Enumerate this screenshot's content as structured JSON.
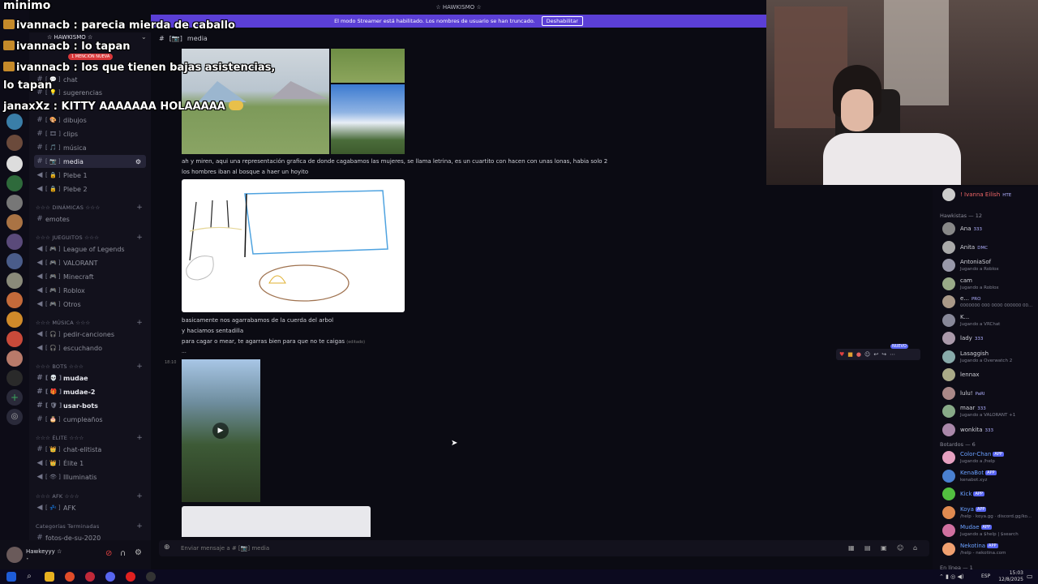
{
  "window": {
    "server_title": "☆ HAWKISMO ☆",
    "banner_text": "El modo Streamer está habilitado. Los nombres de usuario se han truncado.",
    "banner_button": "Deshabilitar"
  },
  "header": {
    "channel": "media",
    "channel_prefix": "[📷]"
  },
  "sidebar": {
    "server_name": "☆ HAWKISMO ☆",
    "mention_badge": "1 MENCIÓN NUEVA",
    "channels_top": [
      {
        "label": "chat"
      },
      {
        "label": "sugerencias"
      },
      {
        "label": "dibujos"
      },
      {
        "label": "clips"
      },
      {
        "label": "música"
      },
      {
        "label": "media",
        "active": true
      },
      {
        "label": "Plebe 1"
      },
      {
        "label": "Plebe 2"
      }
    ],
    "cat_dinamicas": "☆☆☆ DINÁMICAS ☆☆☆",
    "ch_emotes": "emotes",
    "cat_jueguitos": "☆☆☆ JUEGUITOS ☆☆☆",
    "voice_games": [
      "League of Legends",
      "VALORANT",
      "Minecraft",
      "Roblox",
      "Otros"
    ],
    "cat_musica": "☆☆☆ MÚSICA ☆☆☆",
    "voice_music": [
      "pedir-canciones",
      "escuchando"
    ],
    "cat_bots": "☆☆☆ BOTS ☆☆☆",
    "bots": [
      "mudae",
      "mudae-2",
      "usar-bots",
      "cumpleaños"
    ],
    "cat_elite": "☆☆☆ ÉLITE ☆☆☆",
    "elite": [
      "chat-elitista",
      "Élite 1",
      "Illuminatis"
    ],
    "cat_afk": "☆☆☆ AFK ☆☆☆",
    "afk": "AFK",
    "cat_terminadas": "Categorías Terminadas",
    "ch_fotos": "fotos-de-su-2020"
  },
  "user": {
    "name": "Hawkeyyy ☆",
    "status": "•"
  },
  "messages": {
    "m1_line1": "ah y miren, aqui una representación grafica de donde cagabamos las mujeres, se llama letrina, es un cuartito con hacen con unas lonas, habia solo 2",
    "m1_line2": "los hombres iban al bosque a haer un hoyito",
    "m2_line1": "basicamente nos agarrabamos de la cuerda del arbol",
    "m2_line2": "y haciamos sentadilla",
    "m2_line3": "para cagar o mear, te agarras bien para que no te caigas",
    "m2_edited": "(editado)",
    "m2_dots": "...",
    "time": "18:10"
  },
  "composer": {
    "placeholder": "Enviar mensaje a # [📷] media"
  },
  "overlay_chat": [
    {
      "user": "minimo",
      "text": ""
    },
    {
      "user": "ivannacb",
      "text": ": parecia mierda de caballo"
    },
    {
      "user": "ivannacb",
      "text": ": lo tapan"
    },
    {
      "user": "ivannacb",
      "text": ": los que tienen bajas asistencias,"
    },
    {
      "user": "",
      "text": "lo tapan"
    },
    {
      "user": "janaxXz",
      "text": ": KITTY AAAAAAA HOLAAAAA"
    }
  ],
  "reaction_bar": {
    "new_label": "NUEVO"
  },
  "members": {
    "top_member": {
      "name": "! Ivanna Eilish",
      "tag": "HTE"
    },
    "group1_header": "Hawkistas — 12",
    "group1": [
      {
        "name": "Ana",
        "badge": "333",
        "status": ""
      },
      {
        "name": "Anita",
        "badge": "DMC",
        "status": ""
      },
      {
        "name": "AntoniaSof",
        "badge": "",
        "status": "Jugando a Roblox"
      },
      {
        "name": "cam",
        "badge": "",
        "status": "Jugando a Roblox"
      },
      {
        "name": "e...",
        "badge": "PRO",
        "status": "0000000 000 0000 000000 00..."
      },
      {
        "name": "K...",
        "badge": "",
        "status": "Jugando a VRChat"
      },
      {
        "name": "lady",
        "badge": "333",
        "status": ""
      },
      {
        "name": "Lasaggish",
        "badge": "",
        "status": "Jugando a Overwatch 2"
      },
      {
        "name": "lennax",
        "badge": "",
        "status": ""
      },
      {
        "name": "lulu!",
        "badge": "PaRI",
        "status": ""
      },
      {
        "name": "maar",
        "badge": "333",
        "status": "Jugando a VALORANT +1"
      },
      {
        "name": "wonkita",
        "badge": "333",
        "status": ""
      }
    ],
    "group2_header": "Botardos — 6",
    "group2": [
      {
        "name": "Color-Chan",
        "status": "Jugando a /help"
      },
      {
        "name": "KenaBot",
        "status": "kenabot.xyz"
      },
      {
        "name": "Kick",
        "status": ""
      },
      {
        "name": "Koya",
        "status": "/help · koya.gg · discord.gg/ko..."
      },
      {
        "name": "Mudae",
        "status": "Jugando a $help | $search"
      },
      {
        "name": "Nekotina",
        "status": "/help - nekotina.com"
      }
    ],
    "app_label": "APP",
    "group3_header": "En línea — 1"
  },
  "taskbar": {
    "lang": "ESP",
    "time": "15:03",
    "date": "12/8/2025"
  },
  "colors": {
    "accent": "#5865f2",
    "banner": "#5b3fd6",
    "bg": "#0b0b13"
  }
}
